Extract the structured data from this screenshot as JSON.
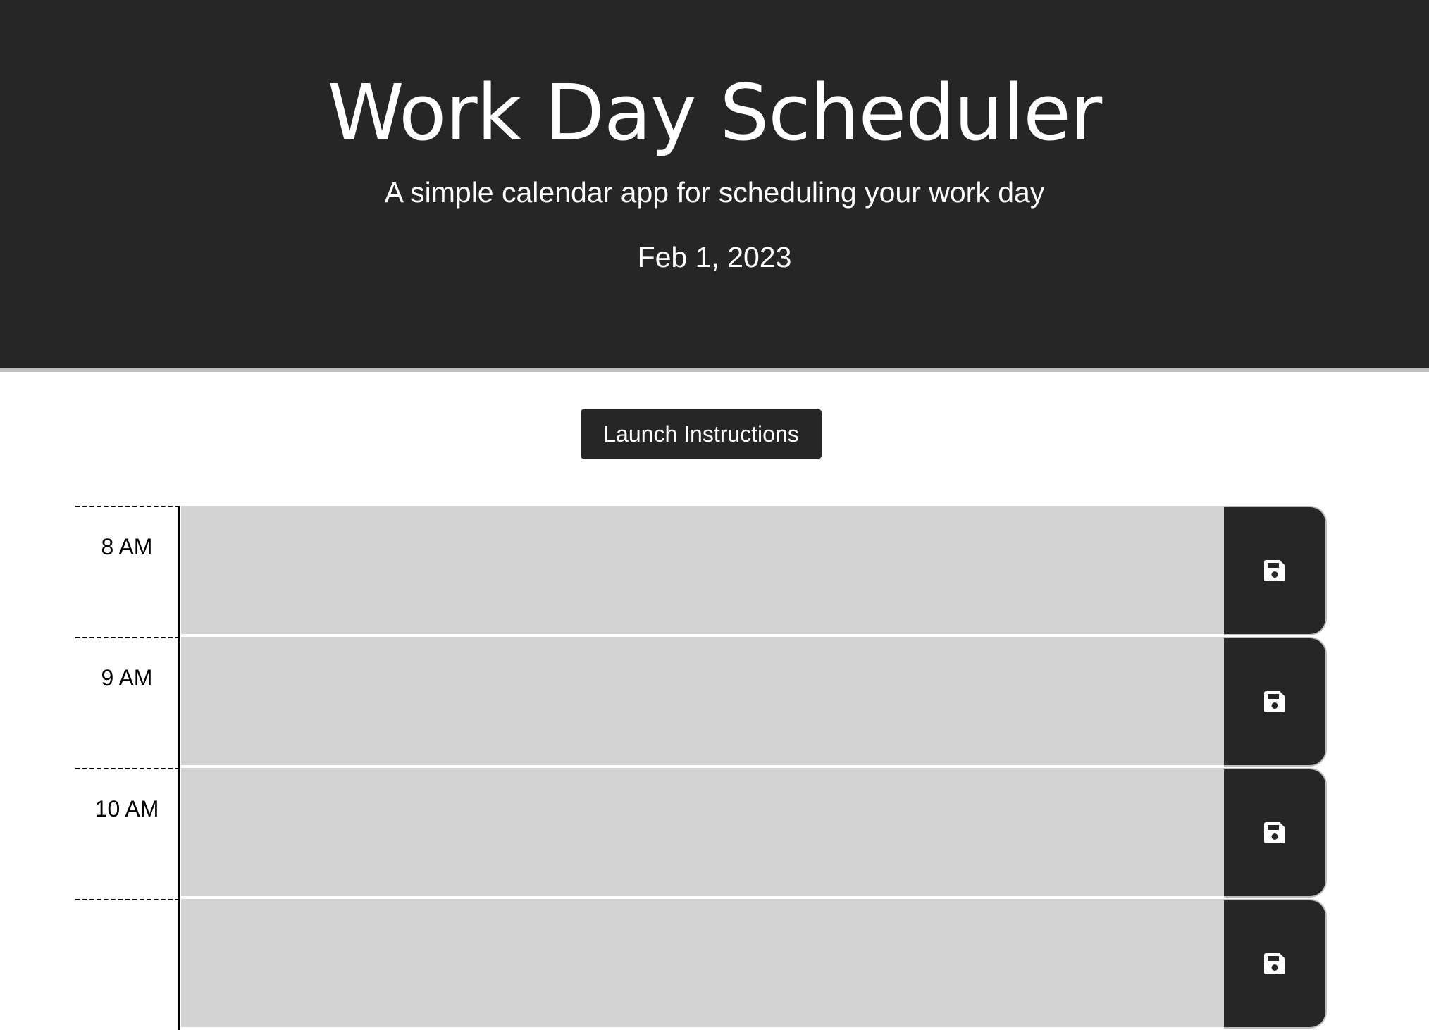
{
  "header": {
    "title": "Work Day Scheduler",
    "subtitle": "A simple calendar app for scheduling your work day",
    "current_date": "Feb 1, 2023"
  },
  "launch_button": {
    "label": "Launch Instructions"
  },
  "time_blocks": [
    {
      "hour": "8 AM",
      "text": "",
      "save_icon": "floppy-disk-icon"
    },
    {
      "hour": "9 AM",
      "text": "",
      "save_icon": "floppy-disk-icon"
    },
    {
      "hour": "10 AM",
      "text": "",
      "save_icon": "floppy-disk-icon"
    },
    {
      "hour": "",
      "text": "",
      "save_icon": "floppy-disk-icon"
    }
  ],
  "colors": {
    "header_bg": "#262626",
    "block_bg": "#d3d3d3",
    "button_bg": "#262626",
    "divider": "#bdbdbd"
  }
}
